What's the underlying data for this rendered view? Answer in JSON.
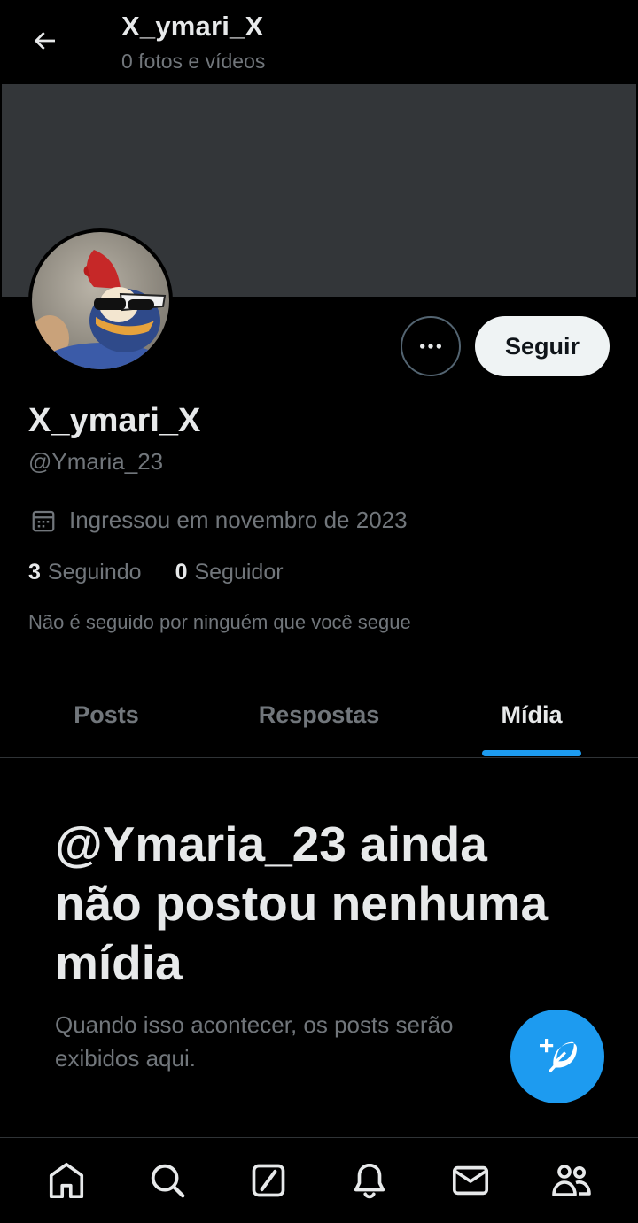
{
  "header": {
    "title": "X_ymari_X",
    "subtitle": "0 fotos e vídeos",
    "back_icon": "arrow-left-icon"
  },
  "profile": {
    "display_name": "X_ymari_X",
    "handle": "@Ymaria_23",
    "joined": "Ingressou em novembro de 2023",
    "following_count": "3",
    "following_label": "Seguindo",
    "followers_count": "0",
    "followers_label": "Seguidor",
    "not_followed_note": "Não é seguido por ninguém que você segue",
    "follow_label": "Seguir"
  },
  "tabs": [
    {
      "label": "Posts",
      "active": false
    },
    {
      "label": "Respostas",
      "active": false
    },
    {
      "label": "Mídia",
      "active": true
    }
  ],
  "empty_state": {
    "title": "@Ymaria_23 ainda não postou nenhuma mídia",
    "description": "Quando isso acontecer, os posts serão exibidos aqui."
  },
  "bottom_nav": [
    {
      "icon": "home-icon"
    },
    {
      "icon": "search-icon"
    },
    {
      "icon": "grok-icon"
    },
    {
      "icon": "bell-icon"
    },
    {
      "icon": "mail-icon"
    },
    {
      "icon": "communities-icon"
    }
  ],
  "colors": {
    "background": "#000000",
    "accent": "#1d9bf0",
    "text_primary": "#e7e9ea",
    "text_secondary": "#71767b",
    "banner": "#333639"
  }
}
